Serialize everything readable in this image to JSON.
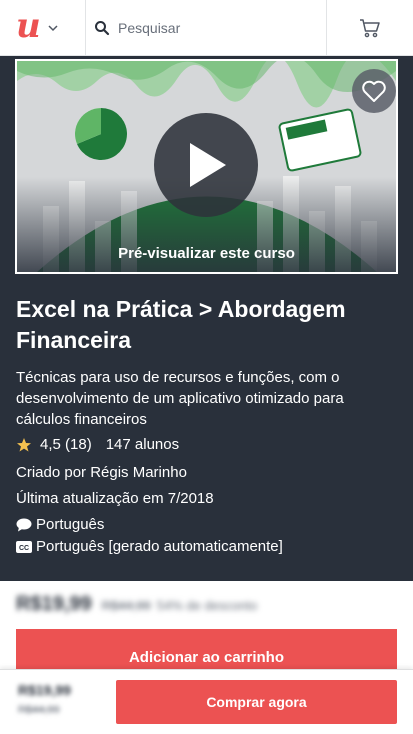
{
  "header": {
    "logo_icon": "udemy-logo-icon",
    "menu_icon": "chevron-down-icon",
    "search_placeholder": "Pesquisar",
    "search_icon": "search-icon",
    "cart_icon": "cart-icon"
  },
  "preview": {
    "label": "Pré-visualizar este curso",
    "play_icon": "play-icon",
    "wishlist_icon": "heart-icon"
  },
  "course": {
    "title": "Excel na Prática > Abordagem Financeira",
    "subtitle": "Técnicas para uso de recursos e funções, com o desenvolvimento de um aplicativo otimizado para cálculos financeiros",
    "rating": "4,5",
    "rating_count": "(18)",
    "students": "147 alunos",
    "created_by": "Criado por Régis Marinho",
    "last_updated": "Última atualização em 7/2018",
    "language": "Português",
    "captions": "Português [gerado automaticamente]"
  },
  "pricing": {
    "current": "R$19,99",
    "original": "R$44,99",
    "discount": "54% de desconto",
    "add_to_cart": "Adicionar ao carrinho",
    "buy_now": "Comprar agora"
  },
  "colors": {
    "accent": "#ec5252",
    "hero_bg": "#29303b",
    "star": "#f4c150"
  }
}
